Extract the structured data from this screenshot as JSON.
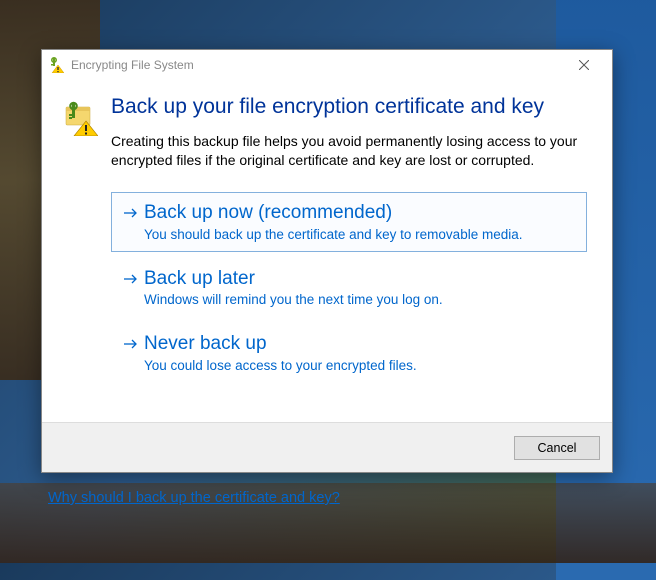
{
  "titlebar": {
    "title": "Encrypting File System"
  },
  "heading": "Back up your file encryption certificate and key",
  "description": "Creating this backup file helps you avoid permanently losing access to your encrypted files if the original certificate and key are lost or corrupted.",
  "options": [
    {
      "title": "Back up now (recommended)",
      "desc": "You should back up the certificate and key to removable media."
    },
    {
      "title": "Back up later",
      "desc": "Windows will remind you the next time you log on."
    },
    {
      "title": "Never back up",
      "desc": "You could lose access to your encrypted files."
    }
  ],
  "footer": {
    "cancel_label": "Cancel"
  },
  "help_link": "Why should I back up the certificate and key?"
}
